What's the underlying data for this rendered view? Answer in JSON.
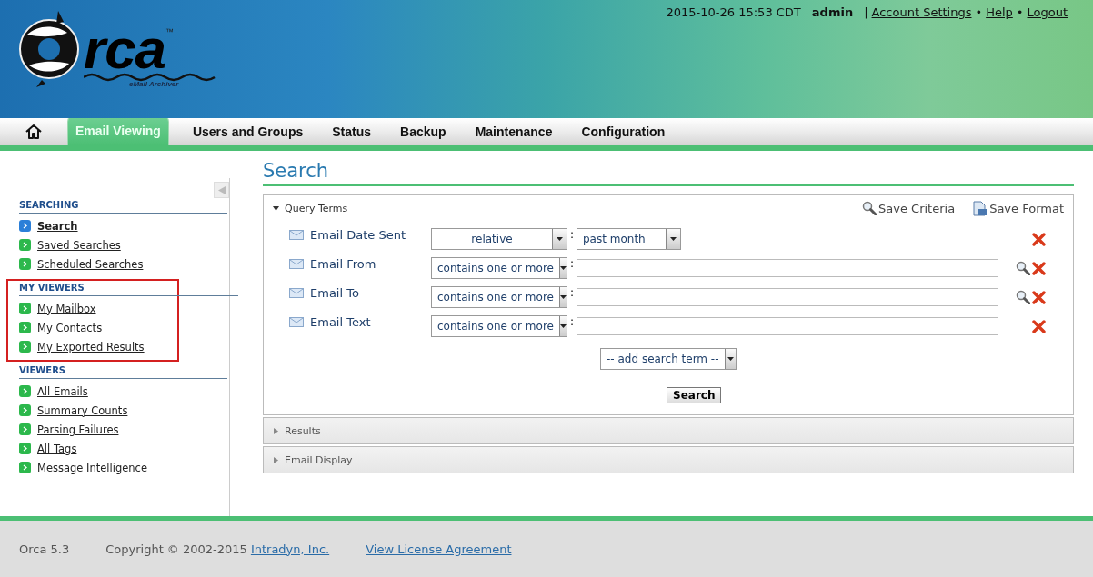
{
  "header": {
    "logo": {
      "text": "rca",
      "tm": "™",
      "tagline": "eMail Archiver"
    },
    "datetime": "2015-10-26 15:53 CDT",
    "user": "admin",
    "separator": "|",
    "links": [
      {
        "label": "Account Settings"
      },
      {
        "label": "Help"
      },
      {
        "label": "Logout"
      }
    ],
    "link_separator": "•"
  },
  "nav": {
    "tabs": [
      {
        "label": "Email Viewing",
        "selected": true
      },
      {
        "label": "Users and Groups",
        "selected": false
      },
      {
        "label": "Status",
        "selected": false
      },
      {
        "label": "Backup",
        "selected": false
      },
      {
        "label": "Maintenance",
        "selected": false
      },
      {
        "label": "Configuration",
        "selected": false
      }
    ]
  },
  "sidebar": {
    "sections": [
      {
        "title": "SEARCHING",
        "highlighted": false,
        "items": [
          {
            "label": "Search",
            "selected": true
          },
          {
            "label": "Saved Searches",
            "selected": false
          },
          {
            "label": "Scheduled Searches",
            "selected": false
          }
        ]
      },
      {
        "title": "MY VIEWERS",
        "highlighted": true,
        "items": [
          {
            "label": "My Mailbox",
            "selected": false
          },
          {
            "label": "My Contacts",
            "selected": false
          },
          {
            "label": "My Exported Results",
            "selected": false
          }
        ]
      },
      {
        "title": "VIEWERS",
        "highlighted": false,
        "items": [
          {
            "label": "All Emails",
            "selected": false
          },
          {
            "label": "Summary Counts",
            "selected": false
          },
          {
            "label": "Parsing Failures",
            "selected": false
          },
          {
            "label": "All Tags",
            "selected": false
          },
          {
            "label": "Message Intelligence",
            "selected": false
          }
        ]
      }
    ]
  },
  "page_title": "Search",
  "panels": [
    {
      "title": "Query Terms",
      "expanded": true
    },
    {
      "title": "Results",
      "expanded": false
    },
    {
      "title": "Email Display",
      "expanded": false
    }
  ],
  "query": {
    "actions": [
      {
        "label": "Save Criteria",
        "kind": "search"
      },
      {
        "label": "Save Format",
        "kind": "save"
      }
    ],
    "terms": [
      {
        "label": "Email Date Sent",
        "operator": "relative",
        "operator_centered": true,
        "kind": "select",
        "value": "past month",
        "lookup": false
      },
      {
        "label": "Email From",
        "operator": "contains one or more",
        "operator_centered": false,
        "kind": "text",
        "lookup": true
      },
      {
        "label": "Email To",
        "operator": "contains one or more",
        "operator_centered": false,
        "kind": "text",
        "lookup": true
      },
      {
        "label": "Email Text",
        "operator": "contains one or more",
        "operator_centered": false,
        "kind": "text",
        "lookup": false
      }
    ],
    "separator": ":",
    "add_term": "-- add search term --",
    "submit": "Search"
  },
  "footer": {
    "version": "Orca 5.3",
    "copyright": "Copyright © 2002-2015",
    "company": "Intradyn, Inc. ",
    "license": "View License Agreement"
  }
}
